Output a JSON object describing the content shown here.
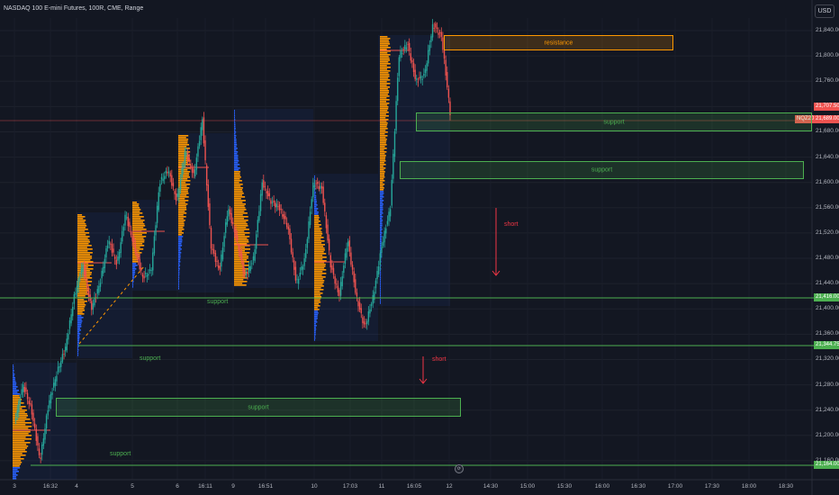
{
  "header": {
    "title": "NASDAQ 100 E-mini Futures, 100R, CME, Range",
    "currency_button": "USD"
  },
  "colors": {
    "background": "#131722",
    "up": "#26a69a",
    "down": "#ef5350",
    "support": "#4caf50",
    "resistance": "#ff9800",
    "short": "#f23645",
    "volume_profile_main": "#ff9800",
    "volume_profile_alt": "#2962ff"
  },
  "price_labels": {
    "last_price": "21,707.50",
    "symbol_tag": "NQZ2024",
    "symbol_price": "21,689.00",
    "support_1": "21,416.00",
    "support_2": "21,344.75",
    "support_3": "21,164.00"
  },
  "annotations": {
    "resistance": "resistance",
    "support": "support",
    "short": "short"
  },
  "controls": {
    "replay_glyph": "⟳"
  },
  "chart_data": {
    "type": "candlestick",
    "title": "NASDAQ 100 E-mini Futures, 100R, CME, Range",
    "y_axis": {
      "range": [
        21130,
        21860
      ],
      "ticks": [
        "21,840.00",
        "21,800.00",
        "21,760.00",
        "21,720.00",
        "21,680.00",
        "21,640.00",
        "21,600.00",
        "21,560.00",
        "21,520.00",
        "21,480.00",
        "21,440.00",
        "21,400.00",
        "21,360.00",
        "21,320.00",
        "21,280.00",
        "21,240.00",
        "21,200.00",
        "21,160.00"
      ]
    },
    "x_axis": {
      "ticks": [
        "3",
        "16:32",
        "4",
        "5",
        "6",
        "16:11",
        "9",
        "16:51",
        "10",
        "17:03",
        "11",
        "16:05",
        "12",
        "14:30",
        "15:00",
        "15:30",
        "16:00",
        "16:30",
        "17:00",
        "17:30",
        "18:00",
        "18:30"
      ]
    },
    "price_path": [
      [
        21220,
        21280
      ],
      [
        21240,
        21160
      ],
      [
        21250,
        21300
      ],
      [
        21340,
        21420
      ],
      [
        21470,
        21400
      ],
      [
        21440,
        21510
      ],
      [
        21470,
        21550
      ],
      [
        21500,
        21450
      ],
      [
        21460,
        21600
      ],
      [
        21620,
        21570
      ],
      [
        21650,
        21610
      ],
      [
        21700,
        21500
      ],
      [
        21460,
        21560
      ],
      [
        21510,
        21450
      ],
      [
        21480,
        21600
      ],
      [
        21570,
        21560
      ],
      [
        21530,
        21440
      ],
      [
        21480,
        21600
      ],
      [
        21590,
        21470
      ],
      [
        21420,
        21510
      ],
      [
        21420,
        21370
      ],
      [
        21420,
        21500
      ],
      [
        21560,
        21800
      ],
      [
        21820,
        21760
      ],
      [
        21770,
        21850
      ],
      [
        21830,
        21710
      ]
    ],
    "levels": [
      {
        "type": "resistance",
        "low": 21800,
        "high": 21825,
        "label": "resistance"
      },
      {
        "type": "support",
        "low": 21680,
        "high": 21710,
        "label": "support"
      },
      {
        "type": "support",
        "low": 21610,
        "high": 21635,
        "label": "support"
      },
      {
        "type": "support",
        "value": 21416,
        "label": "support"
      },
      {
        "type": "support",
        "value": 21344.75,
        "label": "support"
      },
      {
        "type": "support",
        "low": 21245,
        "high": 21270,
        "label": "support"
      },
      {
        "type": "support",
        "value": 21164,
        "label": "support"
      }
    ],
    "signals": [
      {
        "label": "short",
        "direction": "down",
        "from": 21560,
        "to": 21460
      },
      {
        "label": "short",
        "direction": "down",
        "from": 21345,
        "to": 21300
      }
    ],
    "last_price": 21707.5
  }
}
